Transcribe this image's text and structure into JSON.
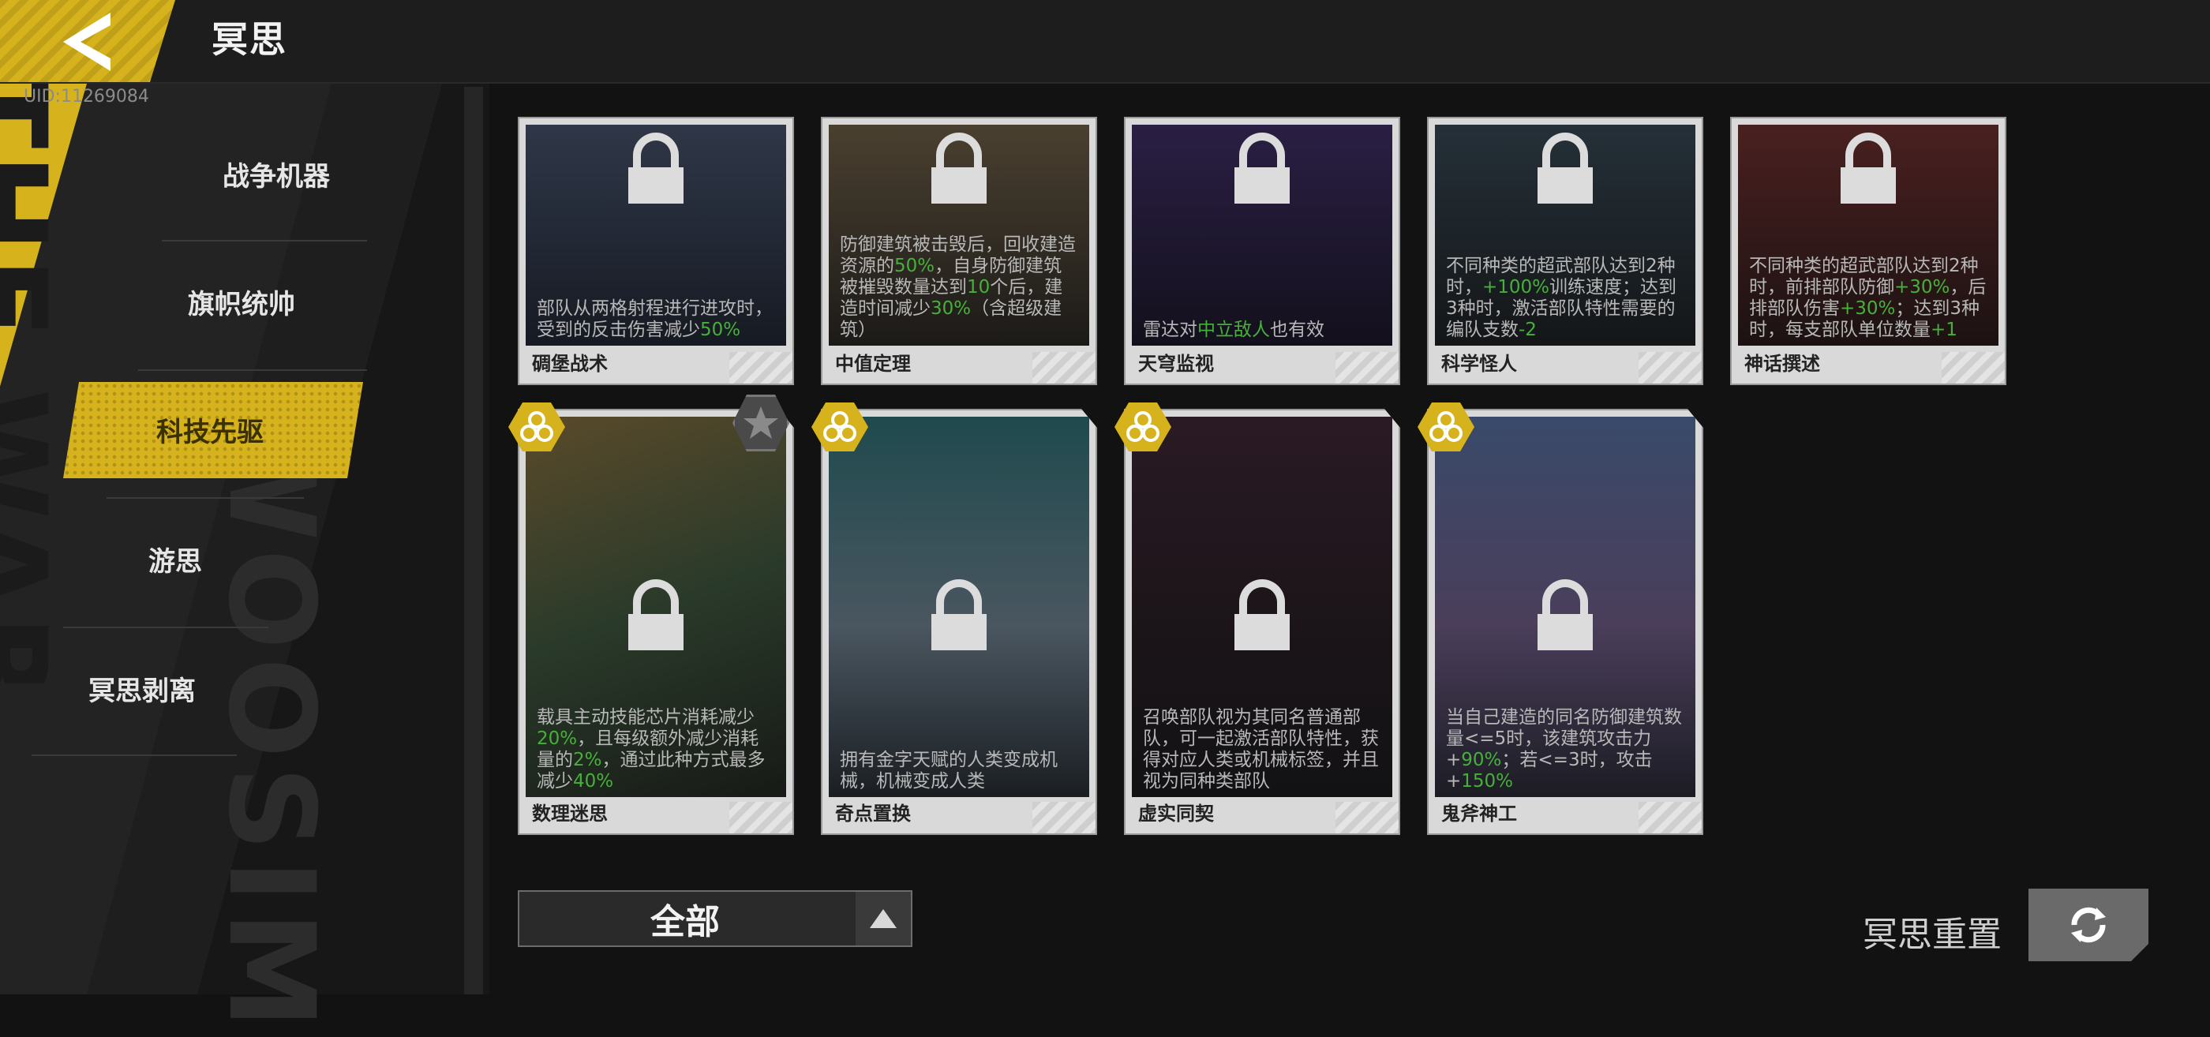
{
  "header": {
    "title": "冥思",
    "uid": "UID:11269084"
  },
  "side_decor": {
    "yellow_text": "THE WAR",
    "watermark": "WOOSIM"
  },
  "sidebar": {
    "items": [
      {
        "label": "战争机器"
      },
      {
        "label": "旗帜统帅"
      },
      {
        "label": "科技先驱",
        "active": true
      },
      {
        "label": "游思"
      },
      {
        "label": "冥思剥离"
      }
    ]
  },
  "cards": [
    {
      "name": "碉堡战术",
      "desc_parts": [
        "部队从两格射程进行进攻时，受到的反击伤害减少",
        "50%"
      ],
      "locked": true
    },
    {
      "name": "中值定理",
      "desc_parts": [
        "防御建筑被击毁后，回收建造资源的",
        "50%",
        "，自身防御建筑被摧毁数量达到",
        "10",
        "个后，建造时间减少",
        "30%",
        "（含超级建筑）"
      ],
      "locked": true
    },
    {
      "name": "天穹监视",
      "desc_parts": [
        "雷达对",
        "中立敌人",
        "也有效"
      ],
      "locked": true
    },
    {
      "name": "科学怪人",
      "desc_parts": [
        "不同种类的超武部队达到2种时，",
        "+100%",
        "训练速度；达到3种时，激活部队特性需要的编队支数",
        "-2"
      ],
      "locked": true
    },
    {
      "name": "神话撰述",
      "desc_parts": [
        "不同种类的超武部队达到2种时，前排部队防御",
        "+30%",
        "，后排部队伤害",
        "+30%",
        "；达到3种时，每支部队单位数量",
        "+1"
      ],
      "locked": true
    },
    {
      "name": "数理迷思",
      "desc_parts": [
        "载具主动技能芯片消耗减少",
        "20%",
        "，且每级额外减少消耗量的",
        "2%",
        "，通过此种方式最多减少",
        "40%"
      ],
      "locked": true
    },
    {
      "name": "奇点置换",
      "desc_parts": [
        "拥有金字天赋的人类变成机械，机械变成人类"
      ],
      "locked": true
    },
    {
      "name": "虚实同契",
      "desc_parts": [
        "召唤部队视为其同名普通部队，可一起激活部队特性，获得对应人类或机械标签，并且视为同种类部队"
      ],
      "locked": true
    },
    {
      "name": "鬼斧神工",
      "desc_parts": [
        "当自己建造的同名防御建筑数量<=5时，该建筑攻击力+",
        "90%",
        "；若<=3时，攻击+",
        "150%"
      ],
      "locked": true
    }
  ],
  "filter": {
    "label": "全部"
  },
  "reset": {
    "label": "冥思重置"
  },
  "colors": {
    "accent": "#d6b21c",
    "green": "#46b03a",
    "background": "#121212"
  }
}
